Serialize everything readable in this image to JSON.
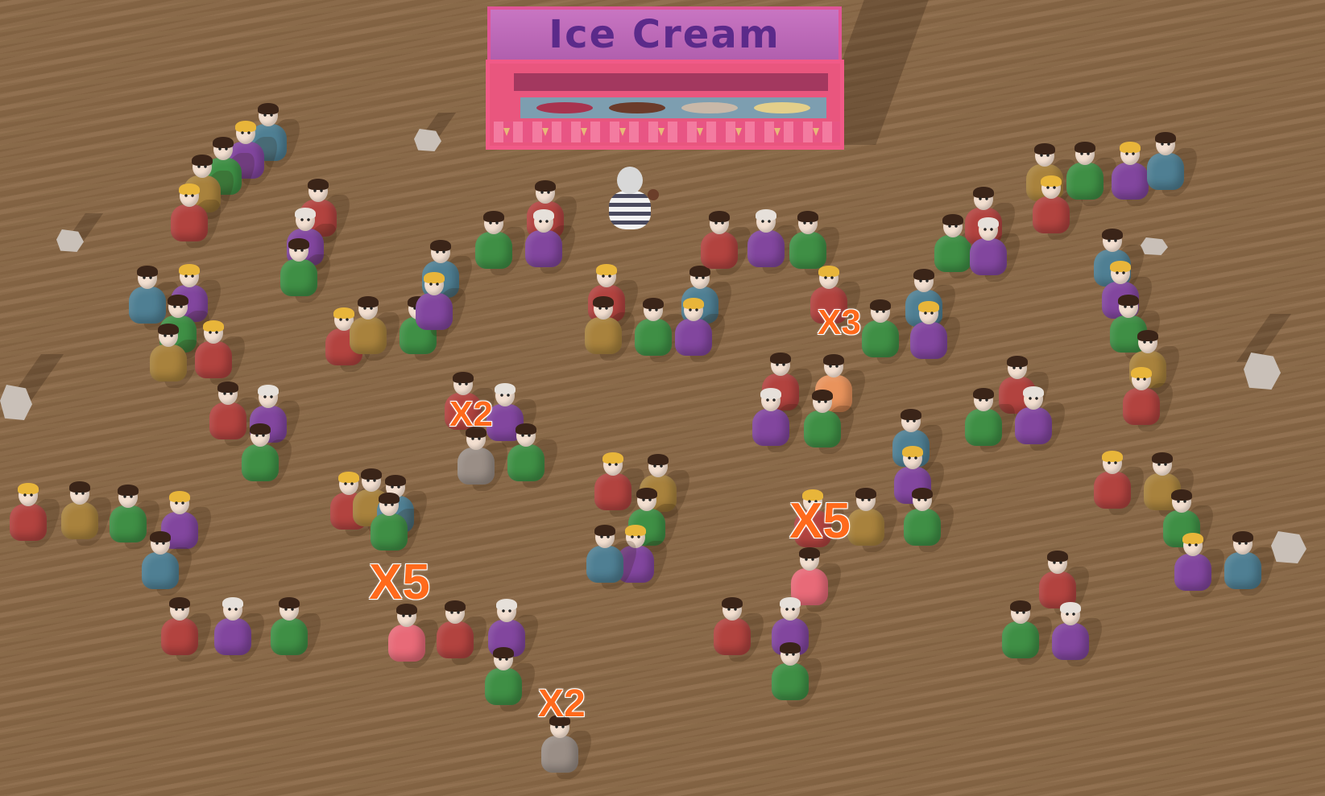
{
  "stand": {
    "title": "Ice Cream"
  },
  "multipliers": [
    {
      "label": "X3"
    },
    {
      "label": "X2"
    },
    {
      "label": "X5"
    },
    {
      "label": "X5"
    },
    {
      "label": "X2"
    }
  ],
  "colors": {
    "ground": "#8c6a48",
    "stand_sign": "#b15fae",
    "stand_body": "#e9567e",
    "multiplier_text": "#ff6a1c",
    "shirt_red": "#b2433f",
    "shirt_green": "#3f8f45",
    "shirt_purple": "#82469e",
    "shirt_blue": "#4f7f93",
    "shirt_mustard": "#a8823d",
    "shirt_pink": "#e86a78",
    "shirt_orange": "#e9935c",
    "shirt_gray": "#9a8e86"
  }
}
